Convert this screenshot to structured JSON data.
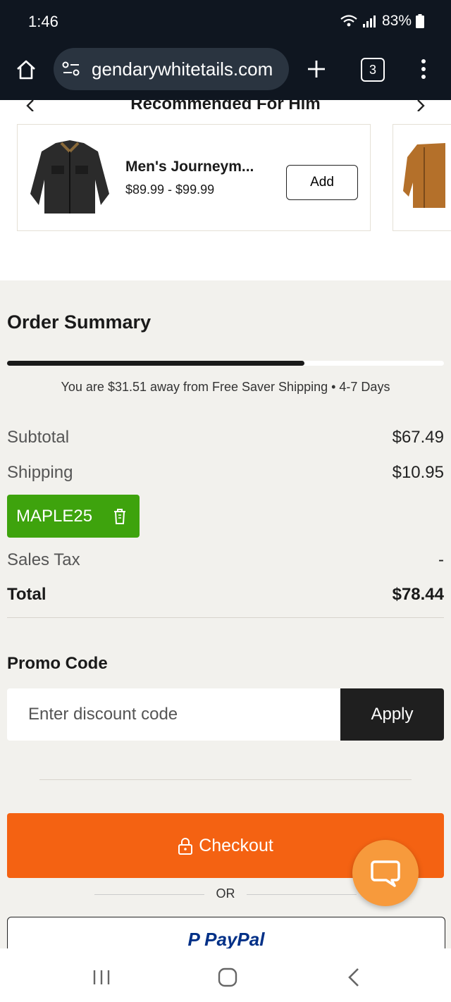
{
  "status_bar": {
    "time": "1:46",
    "battery": "83%"
  },
  "browser": {
    "url": "gendarywhitetails.com",
    "tab_count": "3"
  },
  "recommended": {
    "title": "Recommended For Him",
    "product": {
      "name": "Men's Journeym...",
      "price": "$89.99 - $99.99",
      "add_label": "Add"
    }
  },
  "order_summary": {
    "title": "Order Summary",
    "shipping_progress": 0.68,
    "shipping_message": "You are $31.51 away from Free Saver Shipping • 4-7 Days",
    "subtotal_label": "Subtotal",
    "subtotal_value": "$67.49",
    "shipping_label": "Shipping",
    "shipping_value": "$10.95",
    "applied_code": "MAPLE25",
    "tax_label": "Sales Tax",
    "tax_value": "-",
    "total_label": "Total",
    "total_value": "$78.44"
  },
  "promo": {
    "title": "Promo Code",
    "placeholder": "Enter discount code",
    "apply_label": "Apply"
  },
  "checkout": {
    "label": "Checkout",
    "or_label": "OR",
    "paypal_label": "PayPal"
  },
  "colors": {
    "accent": "#f46212",
    "promo_green": "#3ea30d",
    "chat": "#f79a3c",
    "paypal_blue": "#003087",
    "paypal_light": "#009cde"
  }
}
